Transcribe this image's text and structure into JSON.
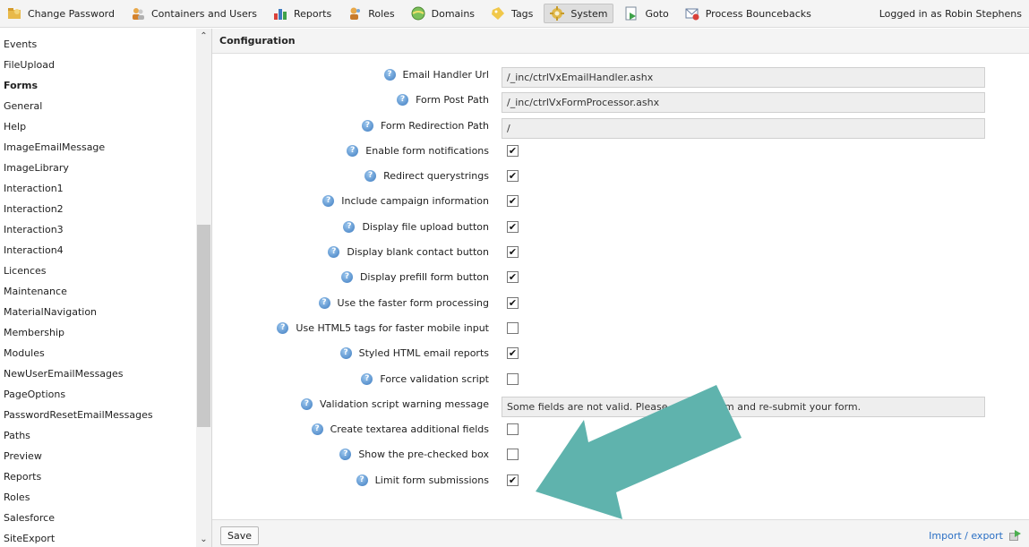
{
  "topbar": {
    "items": [
      {
        "label": "Change Password",
        "icon": "key-folder-icon"
      },
      {
        "label": "Containers and Users",
        "icon": "users-icon"
      },
      {
        "label": "Reports",
        "icon": "bar-chart-icon"
      },
      {
        "label": "Roles",
        "icon": "roles-icon"
      },
      {
        "label": "Domains",
        "icon": "globe-icon"
      },
      {
        "label": "Tags",
        "icon": "tag-icon"
      },
      {
        "label": "System",
        "icon": "gear-icon"
      },
      {
        "label": "Goto",
        "icon": "goto-icon"
      },
      {
        "label": "Process Bouncebacks",
        "icon": "mail-bounce-icon"
      }
    ],
    "active_item": "System",
    "logged_in": "Logged in as Robin Stephens"
  },
  "sidebar": {
    "active": "Forms",
    "items": [
      "Events",
      "FileUpload",
      "Forms",
      "General",
      "Help",
      "ImageEmailMessage",
      "ImageLibrary",
      "Interaction1",
      "Interaction2",
      "Interaction3",
      "Interaction4",
      "Licences",
      "Maintenance",
      "MaterialNavigation",
      "Membership",
      "Modules",
      "NewUserEmailMessages",
      "PageOptions",
      "PasswordResetEmailMessages",
      "Paths",
      "Preview",
      "Reports",
      "Roles",
      "Salesforce",
      "SiteExport"
    ]
  },
  "section": {
    "title": "Configuration"
  },
  "settings": [
    {
      "label": "Email Handler Url",
      "type": "text",
      "value": "/_inc/ctrlVxEmailHandler.ashx"
    },
    {
      "label": "Form Post Path",
      "type": "text",
      "value": "/_inc/ctrlVxFormProcessor.ashx"
    },
    {
      "label": "Form Redirection Path",
      "type": "text",
      "value": "/"
    },
    {
      "label": "Enable form notifications",
      "type": "checkbox",
      "checked": true
    },
    {
      "label": "Redirect querystrings",
      "type": "checkbox",
      "checked": true
    },
    {
      "label": "Include campaign information",
      "type": "checkbox",
      "checked": true
    },
    {
      "label": "Display file upload button",
      "type": "checkbox",
      "checked": true
    },
    {
      "label": "Display blank contact button",
      "type": "checkbox",
      "checked": true
    },
    {
      "label": "Display prefill form button",
      "type": "checkbox",
      "checked": true
    },
    {
      "label": "Use the faster form processing",
      "type": "checkbox",
      "checked": true
    },
    {
      "label": "Use HTML5 tags for faster mobile input",
      "type": "checkbox",
      "checked": false
    },
    {
      "label": "Styled HTML email reports",
      "type": "checkbox",
      "checked": true
    },
    {
      "label": "Force validation script",
      "type": "checkbox",
      "checked": false
    },
    {
      "label": "Validation script warning message",
      "type": "text",
      "value": "Some fields are not valid. Please correct them and re-submit your form."
    },
    {
      "label": "Create textarea additional fields",
      "type": "checkbox",
      "checked": false
    },
    {
      "label": "Show the pre-checked box",
      "type": "checkbox",
      "checked": false
    },
    {
      "label": "Limit form submissions",
      "type": "checkbox",
      "checked": true
    }
  ],
  "footer": {
    "save_label": "Save",
    "import_label": "Import / export"
  },
  "colors": {
    "arrow": "#5fb3ad",
    "link": "#2a6fc4"
  },
  "check_mark": "✔"
}
